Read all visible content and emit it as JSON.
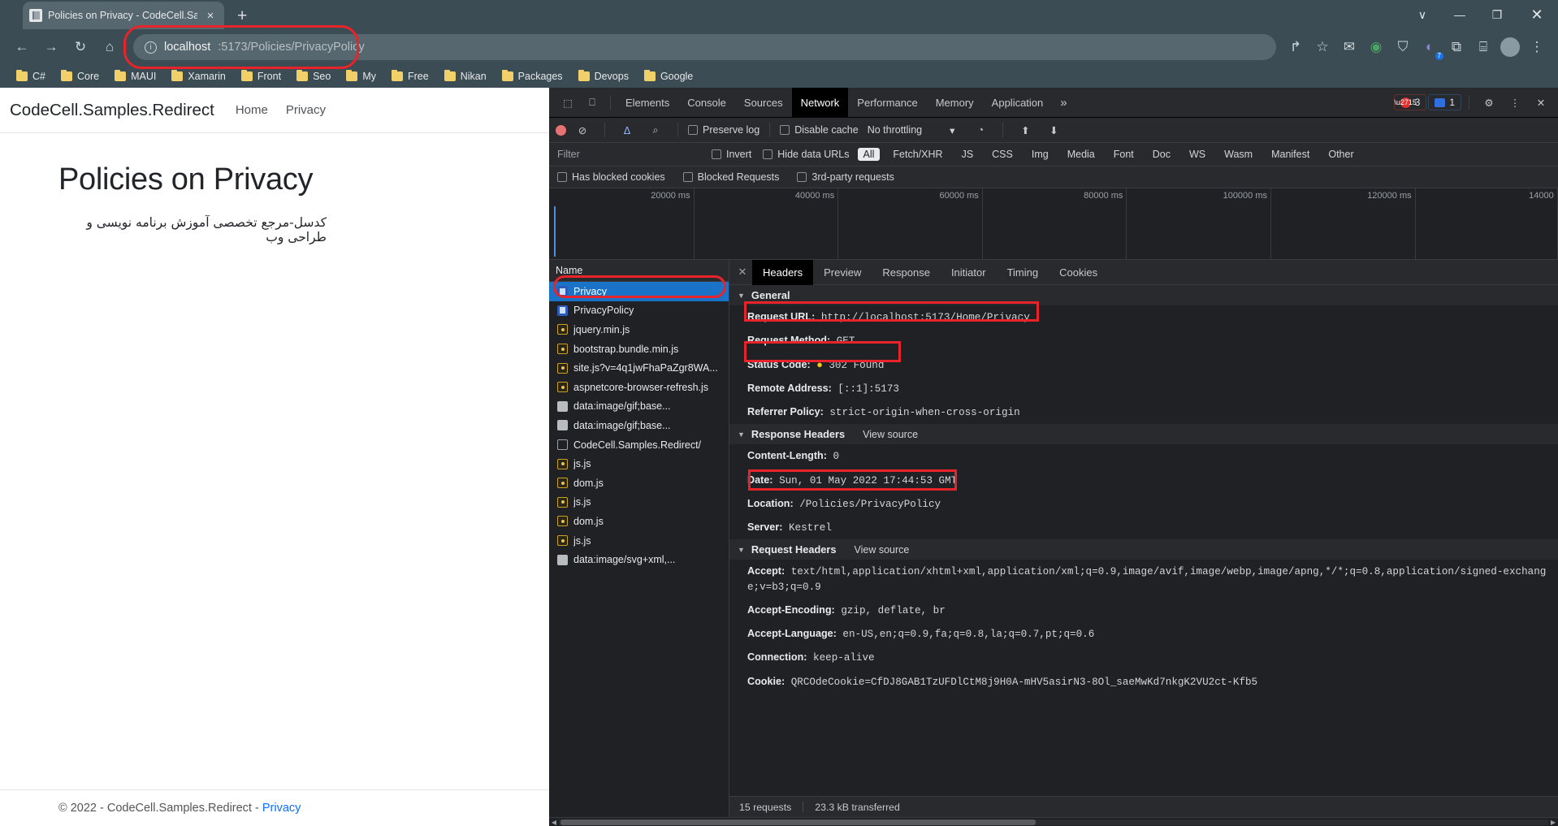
{
  "browser": {
    "tab": {
      "title": "Policies on Privacy - CodeCell.Sa",
      "favicon": "page-icon",
      "close": "×"
    },
    "new_tab": "+",
    "window_controls": {
      "minimize_more": "∨",
      "minimize": "—",
      "maximize": "❐",
      "close": "✕"
    },
    "nav": {
      "back": "←",
      "forward": "→",
      "reload": "↻",
      "home": "⌂"
    },
    "omnibox": {
      "info_icon": "ⓘ",
      "host": "localhost",
      "path": ":5173/Policies/PrivacyPolicy",
      "full_url": "localhost:5173/Policies/PrivacyPolicy"
    },
    "toolbar_icons": {
      "share": "↱",
      "bookmark_star": "☆",
      "mail": "✉",
      "extension_green": "◉",
      "shield": "⛉",
      "puzzle_badge": "◐",
      "extensions": "⧉",
      "sidepanel": "⌸",
      "profile": "●",
      "menu": "⋮",
      "puzzle_count": "7"
    },
    "bookmarks": [
      {
        "label": "C#"
      },
      {
        "label": "Core"
      },
      {
        "label": "MAUI"
      },
      {
        "label": "Xamarin"
      },
      {
        "label": "Front"
      },
      {
        "label": "Seo"
      },
      {
        "label": "My"
      },
      {
        "label": "Free"
      },
      {
        "label": "Nikan"
      },
      {
        "label": "Packages"
      },
      {
        "label": "Devops"
      },
      {
        "label": "Google"
      }
    ]
  },
  "page": {
    "brand": "CodeCell.Samples.Redirect",
    "nav_links": [
      {
        "label": "Home"
      },
      {
        "label": "Privacy"
      }
    ],
    "heading": "Policies on Privacy",
    "subtitle": "کدسل-مرجع تخصصی آموزش برنامه نویسی و طراحی وب",
    "footer_text": "© 2022 - CodeCell.Samples.Redirect - ",
    "footer_link": "Privacy"
  },
  "devtools": {
    "inspect_icon": "⬚",
    "device_icon": "⎕",
    "tabs": [
      {
        "label": "Elements",
        "active": false
      },
      {
        "label": "Console",
        "active": false
      },
      {
        "label": "Sources",
        "active": false
      },
      {
        "label": "Network",
        "active": true
      },
      {
        "label": "Performance",
        "active": false
      },
      {
        "label": "Memory",
        "active": false
      },
      {
        "label": "Application",
        "active": false
      }
    ],
    "more_tabs": "»",
    "error_count": "3",
    "message_count": "1",
    "settings_icon": "⚙",
    "kebab_icon": "⋮",
    "close_icon": "✕",
    "toolbar": {
      "record_icon": "record-dot",
      "clear_icon": "⊘",
      "filter_icon": "ᐃ",
      "search_icon": "⌕",
      "preserve_log": "Preserve log",
      "disable_cache": "Disable cache",
      "throttling": "No throttling",
      "throttling_caret": "▾",
      "wifi_icon": "◔",
      "upload_icon": "⬆",
      "download_icon": "⬇"
    },
    "filter_row": {
      "placeholder": "Filter",
      "invert": "Invert",
      "hide_data_urls": "Hide data URLs",
      "types": [
        {
          "label": "All",
          "active": true
        },
        {
          "label": "Fetch/XHR",
          "active": false
        },
        {
          "label": "JS",
          "active": false
        },
        {
          "label": "CSS",
          "active": false
        },
        {
          "label": "Img",
          "active": false
        },
        {
          "label": "Media",
          "active": false
        },
        {
          "label": "Font",
          "active": false
        },
        {
          "label": "Doc",
          "active": false
        },
        {
          "label": "WS",
          "active": false
        },
        {
          "label": "Wasm",
          "active": false
        },
        {
          "label": "Manifest",
          "active": false
        },
        {
          "label": "Other",
          "active": false
        }
      ]
    },
    "filter_row2": {
      "has_blocked_cookies": "Has blocked cookies",
      "blocked_requests": "Blocked Requests",
      "third_party": "3rd-party requests"
    },
    "timeline_ticks": [
      {
        "label": "20000 ms",
        "pct": 14.3
      },
      {
        "label": "40000 ms",
        "pct": 28.6
      },
      {
        "label": "60000 ms",
        "pct": 42.9
      },
      {
        "label": "80000 ms",
        "pct": 57.2
      },
      {
        "label": "100000 ms",
        "pct": 71.5
      },
      {
        "label": "120000 ms",
        "pct": 85.8
      },
      {
        "label": "14000",
        "pct": 99.9
      }
    ],
    "request_list": {
      "header": "Name",
      "rows": [
        {
          "name": "Privacy",
          "icon": "doc",
          "selected": true
        },
        {
          "name": "PrivacyPolicy",
          "icon": "doc",
          "selected": false
        },
        {
          "name": "jquery.min.js",
          "icon": "js",
          "selected": false
        },
        {
          "name": "bootstrap.bundle.min.js",
          "icon": "js",
          "selected": false
        },
        {
          "name": "site.js?v=4q1jwFhaPaZgr8WA...",
          "icon": "js",
          "selected": false
        },
        {
          "name": "aspnetcore-browser-refresh.js",
          "icon": "js",
          "selected": false
        },
        {
          "name": "data:image/gif;base...",
          "icon": "img",
          "selected": false
        },
        {
          "name": "data:image/gif;base...",
          "icon": "img",
          "selected": false
        },
        {
          "name": "CodeCell.Samples.Redirect/",
          "icon": "other",
          "selected": false
        },
        {
          "name": "js.js",
          "icon": "js",
          "selected": false
        },
        {
          "name": "dom.js",
          "icon": "js",
          "selected": false
        },
        {
          "name": "js.js",
          "icon": "js",
          "selected": false
        },
        {
          "name": "dom.js",
          "icon": "js",
          "selected": false
        },
        {
          "name": "js.js",
          "icon": "js",
          "selected": false
        },
        {
          "name": "data:image/svg+xml,...",
          "icon": "img",
          "selected": false
        }
      ]
    },
    "detail_tabs": [
      {
        "label": "Headers",
        "active": true
      },
      {
        "label": "Preview",
        "active": false
      },
      {
        "label": "Response",
        "active": false
      },
      {
        "label": "Initiator",
        "active": false
      },
      {
        "label": "Timing",
        "active": false
      },
      {
        "label": "Cookies",
        "active": false
      }
    ],
    "general": {
      "title": "General",
      "items": [
        {
          "key": "Request URL:",
          "value": "http://localhost:5173/Home/Privacy",
          "highlight": true
        },
        {
          "key": "Request Method:",
          "value": "GET",
          "highlight": false
        },
        {
          "key": "Status Code:",
          "value": "302 Found",
          "status_dot": true,
          "highlight": true
        },
        {
          "key": "Remote Address:",
          "value": "[::1]:5173",
          "highlight": false
        },
        {
          "key": "Referrer Policy:",
          "value": "strict-origin-when-cross-origin",
          "highlight": false
        }
      ]
    },
    "response_headers": {
      "title": "Response Headers",
      "view_source": "View source",
      "items": [
        {
          "key": "Content-Length:",
          "value": "0",
          "highlight": false
        },
        {
          "key": "Date:",
          "value": "Sun, 01 May 2022 17:44:53 GMT",
          "highlight": false
        },
        {
          "key": "Location:",
          "value": "/Policies/PrivacyPolicy",
          "highlight": true
        },
        {
          "key": "Server:",
          "value": "Kestrel",
          "highlight": false
        }
      ]
    },
    "request_headers": {
      "title": "Request Headers",
      "view_source": "View source",
      "items": [
        {
          "key": "Accept:",
          "value": "text/html,application/xhtml+xml,application/xml;q=0.9,image/avif,image/webp,image/apng,*/*;q=0.8,application/signed-exchange;v=b3;q=0.9"
        },
        {
          "key": "Accept-Encoding:",
          "value": "gzip, deflate, br"
        },
        {
          "key": "Accept-Language:",
          "value": "en-US,en;q=0.9,fa;q=0.8,la;q=0.7,pt;q=0.6"
        },
        {
          "key": "Connection:",
          "value": "keep-alive"
        },
        {
          "key": "Cookie:",
          "value": "QRCOdeCookie=CfDJ8GAB1TzUFDlCtM8j9H0A-mHV5asirN3-8Ol_saeMwKd7nkgK2VU2ct-Kfb5"
        }
      ]
    },
    "status_bar": {
      "requests": "15 requests",
      "transferred": "23.3 kB transferred"
    },
    "scroll_left": "◀",
    "scroll_right": "▶"
  }
}
